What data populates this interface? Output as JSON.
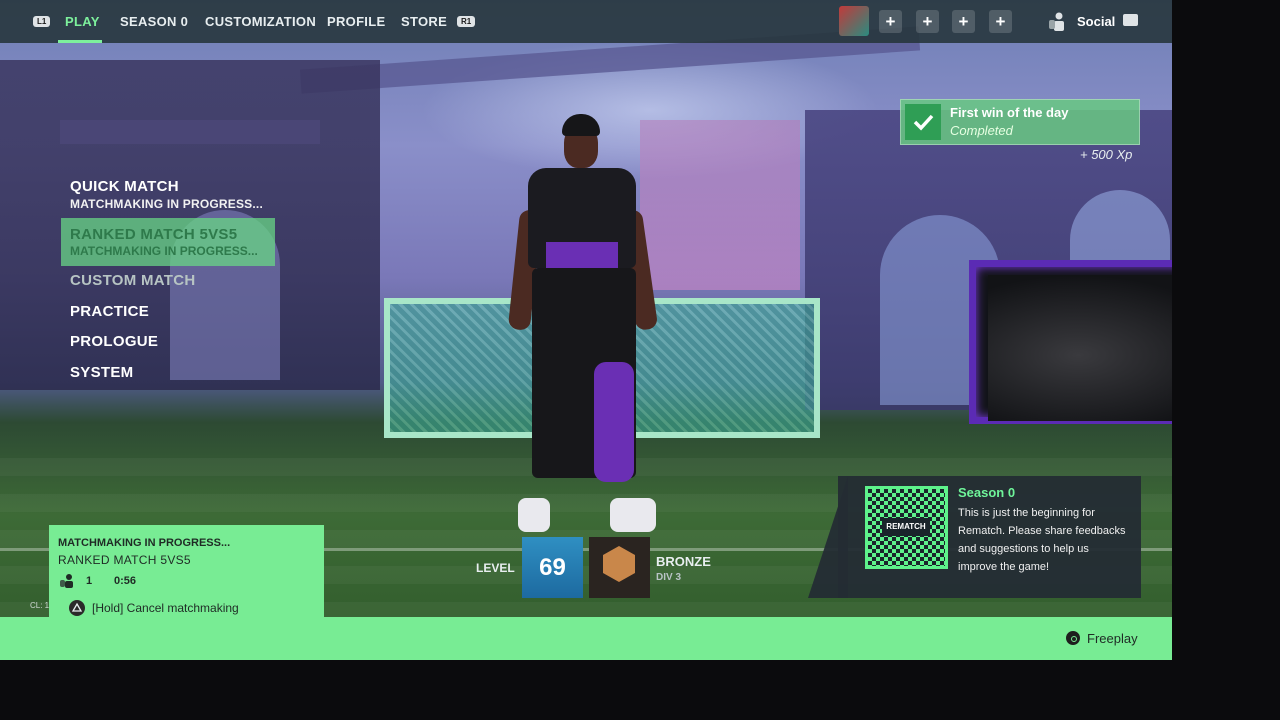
{
  "nav": {
    "left_trigger": "L1",
    "right_trigger": "R1",
    "tabs": [
      "PLAY",
      "SEASON 0",
      "CUSTOMIZATION",
      "PROFILE",
      "STORE"
    ],
    "invite_slots": [
      "+",
      "+",
      "+",
      "+"
    ],
    "social_label": "Social"
  },
  "menu": {
    "quick_match": "QUICK MATCH",
    "quick_match_status": "MATCHMAKING IN PROGRESS...",
    "ranked_match": "RANKED MATCH 5VS5",
    "ranked_match_status": "MATCHMAKING IN PROGRESS...",
    "custom_match": "CUSTOM MATCH",
    "practice": "PRACTICE",
    "prologue": "PROLOGUE",
    "system": "SYSTEM"
  },
  "quest": {
    "title": "First win of the day",
    "status": "Completed",
    "reward": "+ 500 Xp"
  },
  "season": {
    "title": "Season 0",
    "body": "This is just the beginning for Rematch. Please share feedbacks and suggestions to help us improve the game!",
    "qr_logo": "REMATCH"
  },
  "player": {
    "level_label": "LEVEL",
    "level": "69",
    "rank": "BRONZE",
    "division": "DIV 3"
  },
  "matchmaking": {
    "title": "MATCHMAKING IN PROGRESS...",
    "mode": "RANKED MATCH 5VS5",
    "players": "1",
    "time": "0:56",
    "cancel": "[Hold] Cancel matchmaking",
    "cl": "CL: 1"
  },
  "footer": {
    "freeplay": "Freeplay"
  },
  "colors": {
    "accent": "#7df09c",
    "panel_green": "#78ec94",
    "stream_frame": "#5b2bb4"
  }
}
